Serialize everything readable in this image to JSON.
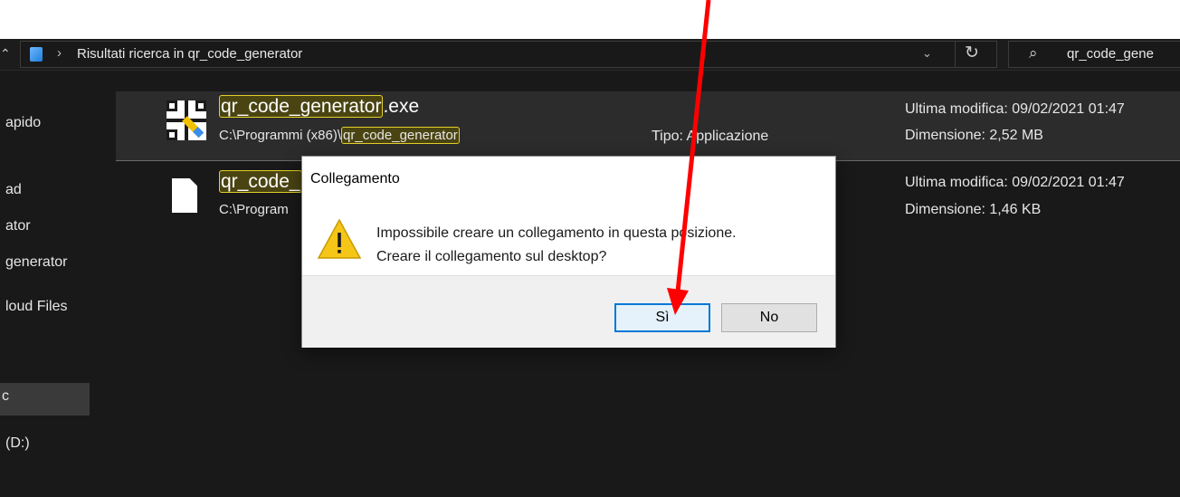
{
  "addressbar": {
    "path_separator": "›",
    "path": "Risultati ricerca in qr_code_generator",
    "dropdown_icon": "chevron-down-icon",
    "refresh_icon": "refresh-icon",
    "search_icon": "search-icon",
    "search_value": "qr_code_gene"
  },
  "sidebar": {
    "items": [
      "apido",
      "ad",
      "ator",
      "generator",
      "loud Files",
      "(D:)"
    ],
    "selected_glyph": "c"
  },
  "results": [
    {
      "name_highlight": "qr_code_generator",
      "name_rest": ".exe",
      "path_prefix": "C:\\Programmi (x86)\\",
      "path_highlight": "qr_code_generator",
      "type": "Tipo: Applicazione",
      "modified": "Ultima modifica: 09/02/2021 01:47",
      "size": "Dimensione: 2,52 MB",
      "icon": "qr-code-app-icon"
    },
    {
      "name_highlight": "qr_code_",
      "path_prefix": "C:\\Program",
      "modified": "Ultima modifica: 09/02/2021 01:47",
      "size": "Dimensione: 1,46 KB",
      "icon": "document-icon"
    }
  ],
  "dialog": {
    "title": "Collegamento",
    "icon": "warning-icon",
    "message_line1": "Impossibile creare un collegamento in questa posizione.",
    "message_line2": "Creare il collegamento sul desktop?",
    "yes_label": "Sì",
    "no_label": "No"
  },
  "annotation": {
    "type": "red-arrow",
    "color": "#ff0000",
    "target": "yes-button"
  },
  "colors": {
    "explorer_bg": "#191919",
    "highlight_border": "#e2d02a",
    "dialog_default_button_border": "#0078d7"
  }
}
